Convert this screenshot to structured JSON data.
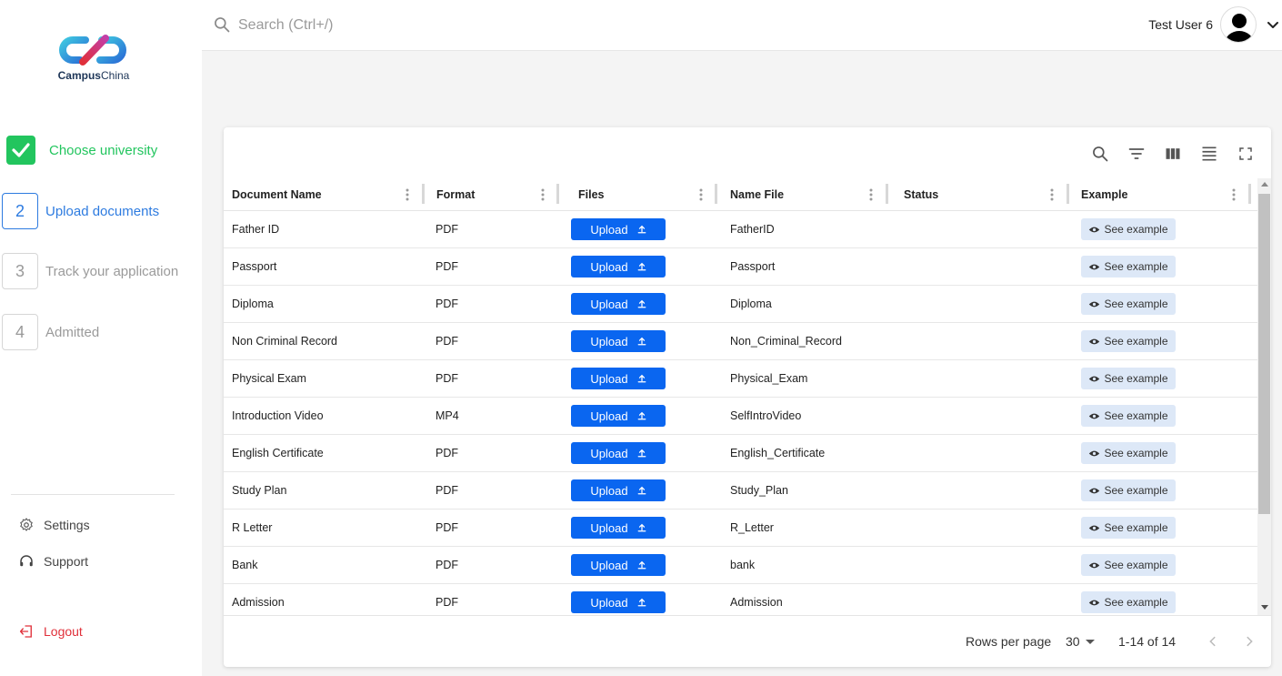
{
  "brand": {
    "name_bold": "Campus",
    "name_regular": "China"
  },
  "steps": [
    {
      "number": "",
      "label": "Choose university",
      "state": "done"
    },
    {
      "number": "2",
      "label": "Upload documents",
      "state": "active"
    },
    {
      "number": "3",
      "label": "Track your application",
      "state": "pending"
    },
    {
      "number": "4",
      "label": "Admitted",
      "state": "pending"
    }
  ],
  "sidebar_links": {
    "settings": "Settings",
    "support": "Support",
    "logout": "Logout"
  },
  "topbar": {
    "search_placeholder": "Search (Ctrl+/)",
    "user_name": "Test User 6"
  },
  "table": {
    "columns": [
      "Document Name",
      "Format",
      "Files",
      "Name File",
      "Status",
      "Example"
    ],
    "upload_label": "Upload",
    "example_label": "See example",
    "rows": [
      {
        "doc": "Father ID",
        "format": "PDF",
        "name_file": "FatherID",
        "status": ""
      },
      {
        "doc": "Passport",
        "format": "PDF",
        "name_file": "Passport",
        "status": ""
      },
      {
        "doc": "Diploma",
        "format": "PDF",
        "name_file": "Diploma",
        "status": ""
      },
      {
        "doc": "Non Criminal Record",
        "format": "PDF",
        "name_file": "Non_Criminal_Record",
        "status": ""
      },
      {
        "doc": "Physical Exam",
        "format": "PDF",
        "name_file": "Physical_Exam",
        "status": ""
      },
      {
        "doc": "Introduction Video",
        "format": "MP4",
        "name_file": "SelfIntroVideo",
        "status": ""
      },
      {
        "doc": "English Certificate",
        "format": "PDF",
        "name_file": "English_Certificate",
        "status": ""
      },
      {
        "doc": "Study Plan",
        "format": "PDF",
        "name_file": "Study_Plan",
        "status": ""
      },
      {
        "doc": "R Letter",
        "format": "PDF",
        "name_file": "R_Letter",
        "status": ""
      },
      {
        "doc": "Bank",
        "format": "PDF",
        "name_file": "bank",
        "status": ""
      },
      {
        "doc": "Admission",
        "format": "PDF",
        "name_file": "Admission",
        "status": ""
      }
    ]
  },
  "pagination": {
    "rows_per_page_label": "Rows per page",
    "rows_per_page": "30",
    "range": "1-14 of 14"
  },
  "colors": {
    "primary": "#0a66f0",
    "success": "#22c55e",
    "active": "#2d7be0",
    "danger": "#e0303a",
    "example_bg": "#dde8f7"
  }
}
